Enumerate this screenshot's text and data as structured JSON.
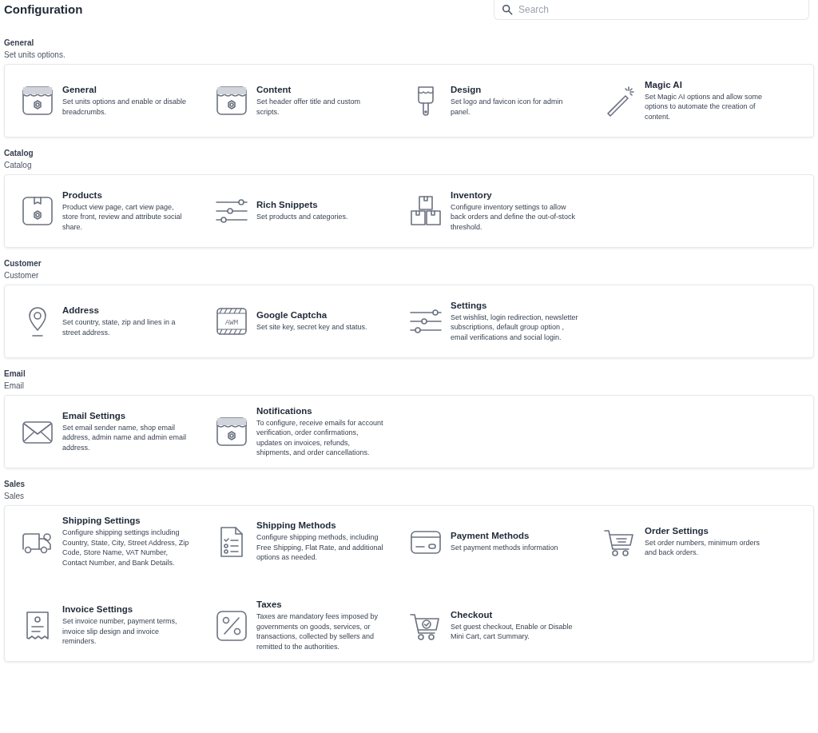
{
  "page_title": "Configuration",
  "search": {
    "placeholder": "Search"
  },
  "sections": [
    {
      "title": "General",
      "subtitle": "Set units options.",
      "items": [
        {
          "kind": "store",
          "title": "General",
          "description": "Set units options and enable or disable breadcrumbs."
        },
        {
          "kind": "store",
          "title": "Content",
          "description": "Set header offer title and custom scripts."
        },
        {
          "kind": "brush",
          "title": "Design",
          "description": "Set logo and favicon icon for admin panel."
        },
        {
          "kind": "wand",
          "title": "Magic AI",
          "description": "Set Magic AI options and allow some options to automate the creation of content."
        }
      ]
    },
    {
      "title": "Catalog",
      "subtitle": "Catalog",
      "items": [
        {
          "kind": "product",
          "title": "Products",
          "description": "Product view page, cart view page, store front, review and attribute social share."
        },
        {
          "kind": "sliders",
          "title": "Rich Snippets",
          "description": "Set products and categories."
        },
        {
          "kind": "boxes",
          "title": "Inventory",
          "description": "Configure inventory settings to allow back orders and define the out-of-stock threshold."
        }
      ]
    },
    {
      "title": "Customer",
      "subtitle": "Customer",
      "items": [
        {
          "kind": "pin",
          "title": "Address",
          "description": "Set country, state, zip and lines in a street address."
        },
        {
          "kind": "captcha",
          "icon_text": "AWM",
          "title": "Google Captcha",
          "description": "Set site key, secret key and status."
        },
        {
          "kind": "sliders",
          "title": "Settings",
          "description": "Set wishlist, login redirection, newsletter subscriptions, default group option , email verifications and social login."
        }
      ]
    },
    {
      "title": "Email",
      "subtitle": "Email",
      "items": [
        {
          "kind": "envelope",
          "title": "Email Settings",
          "description": "Set email sender name, shop email address, admin name and admin email address."
        },
        {
          "kind": "store",
          "title": "Notifications",
          "description": "To configure, receive emails for account verification, order confirmations, updates on invoices, refunds, shipments, and order cancellations."
        }
      ]
    },
    {
      "title": "Sales",
      "subtitle": "Sales",
      "items": [
        {
          "kind": "truck",
          "title": "Shipping Settings",
          "description": "Configure shipping settings including Country, State, City, Street Address, Zip Code, Store Name, VAT Number, Contact Number, and Bank Details."
        },
        {
          "kind": "checklist",
          "title": "Shipping Methods",
          "description": "Configure shipping methods, including Free Shipping, Flat Rate, and additional options as needed."
        },
        {
          "kind": "card",
          "title": "Payment Methods",
          "description": "Set payment methods information"
        },
        {
          "kind": "cart",
          "title": "Order Settings",
          "description": "Set order numbers, minimum orders and back orders."
        },
        {
          "kind": "receipt",
          "title": "Invoice Settings",
          "description": "Set invoice number, payment terms, invoice slip design and invoice reminders."
        },
        {
          "kind": "percent",
          "title": "Taxes",
          "description": "Taxes are mandatory fees imposed by governments on goods, services, or transactions, collected by sellers and remitted to the authorities."
        },
        {
          "kind": "cartcheck",
          "title": "Checkout",
          "description": "Set guest checkout, Enable or Disable Mini Cart, cart Summary."
        }
      ]
    }
  ]
}
